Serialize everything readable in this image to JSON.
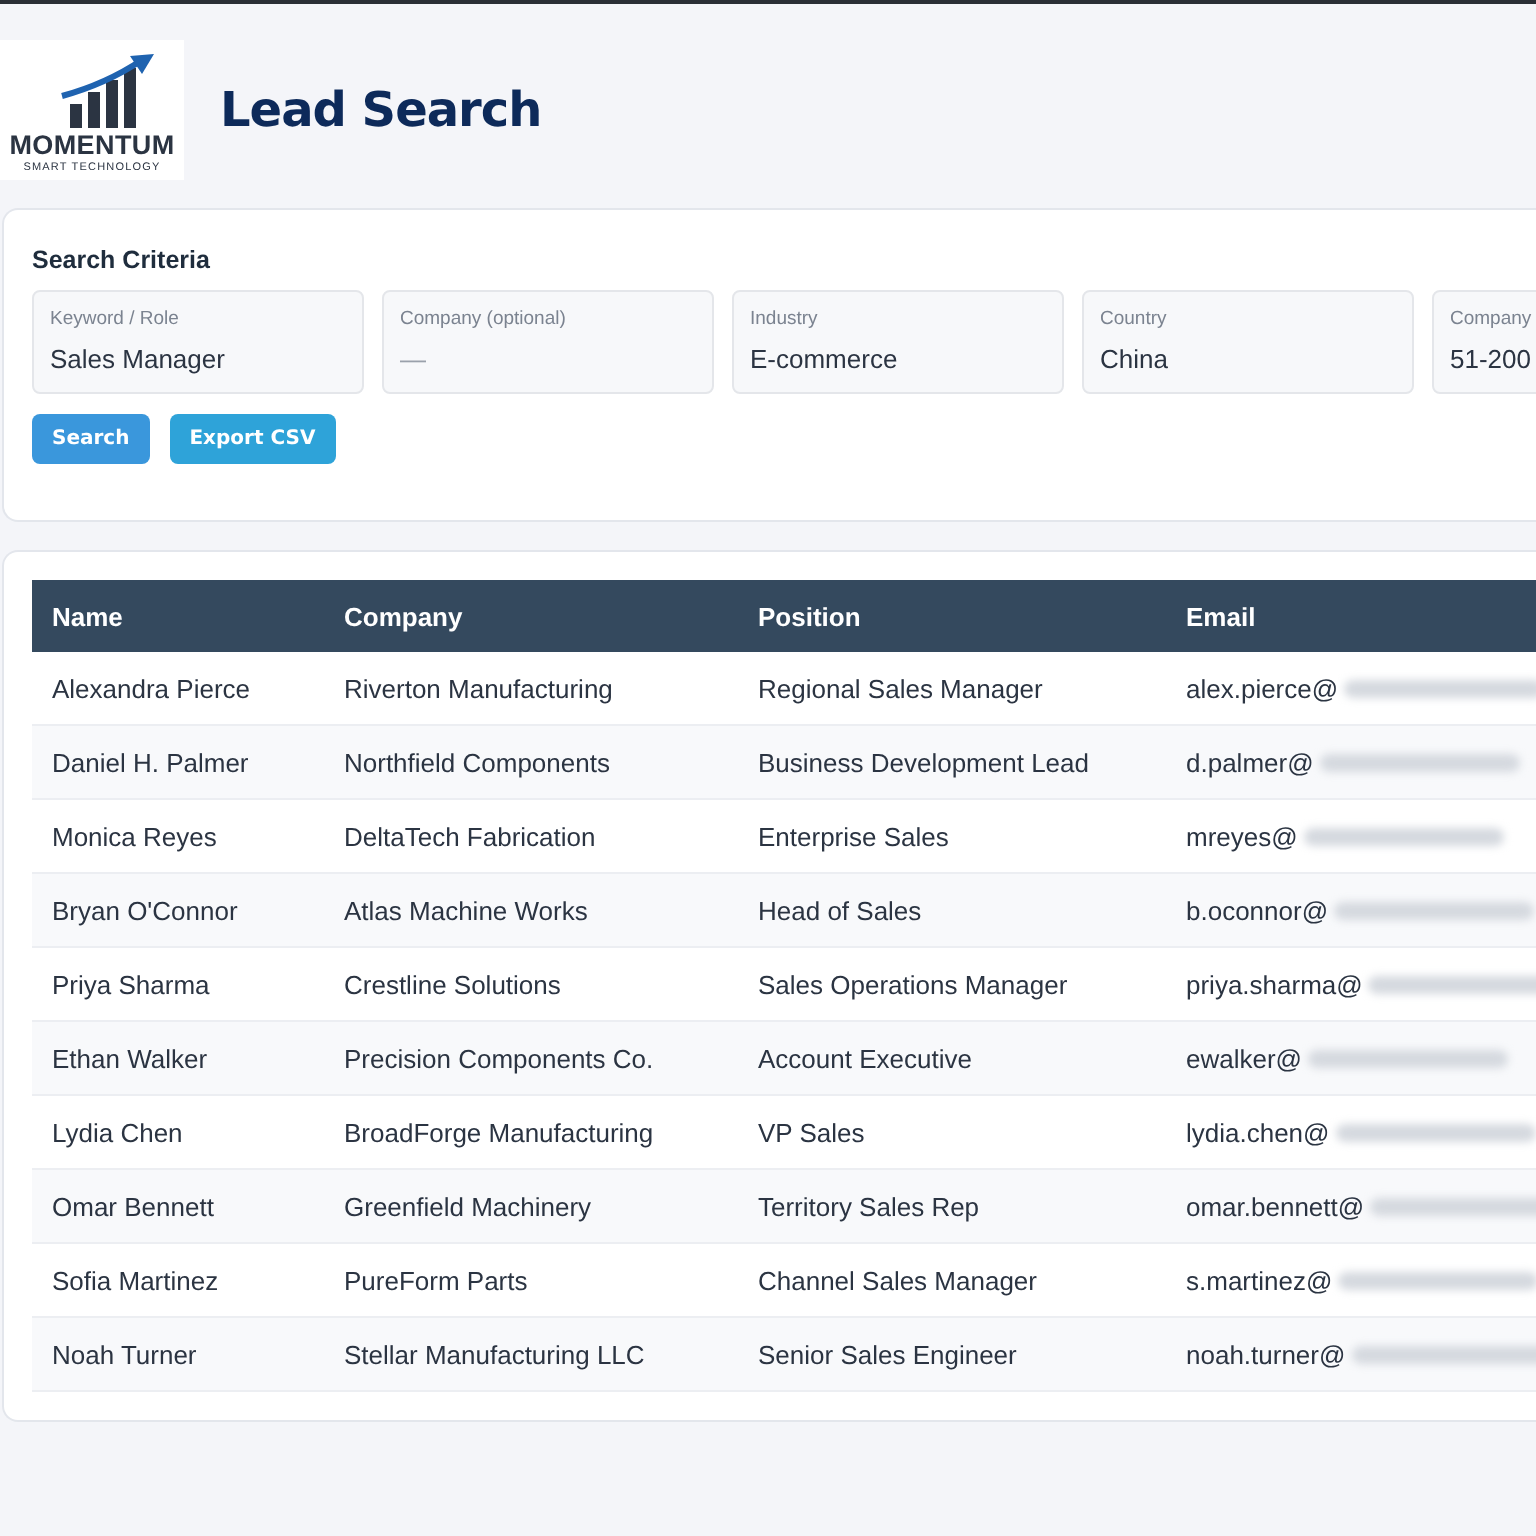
{
  "logo": {
    "name": "MOMENTUM",
    "tagline": "SMART TECHNOLOGY"
  },
  "page_title": "Lead Search",
  "search_criteria": {
    "title": "Search Criteria",
    "fields": [
      {
        "label": "Keyword / Role",
        "value": "Sales Manager"
      },
      {
        "label": "Company (optional)",
        "placeholder": "—"
      },
      {
        "label": "Industry",
        "value": "E-commerce"
      },
      {
        "label": "Country",
        "value": "China"
      },
      {
        "label": "Company",
        "value": "51-200"
      }
    ],
    "buttons": [
      {
        "label": "Search",
        "kind": "primary"
      },
      {
        "label": "Export CSV",
        "kind": "secondary"
      }
    ]
  },
  "table": {
    "columns": [
      "Name",
      "Company",
      "Position",
      "Email"
    ],
    "rows": [
      {
        "name": "Alexandra Pierce",
        "company": "Riverton Manufacturing",
        "position": "Regional Sales Manager",
        "email": "alex.pierce@",
        "email_domain_blurred": true
      },
      {
        "name": "Daniel H. Palmer",
        "company": "Northfield Components",
        "position": "Business Development Lead",
        "email": "d.palmer@",
        "email_domain_blurred": true
      },
      {
        "name": "Monica Reyes",
        "company": "DeltaTech Fabrication",
        "position": "Enterprise Sales",
        "email": "mreyes@",
        "email_domain_blurred": true
      },
      {
        "name": "Bryan O'Connor",
        "company": "Atlas Machine Works",
        "position": "Head of Sales",
        "email": "b.oconnor@",
        "email_domain_blurred": true
      },
      {
        "name": "Priya Sharma",
        "company": "Crestline Solutions",
        "position": "Sales Operations Manager",
        "email": "priya.sharma@",
        "email_domain_blurred": true
      },
      {
        "name": "Ethan Walker",
        "company": "Precision Components Co.",
        "position": "Account Executive",
        "email": "ewalker@",
        "email_domain_blurred": true
      },
      {
        "name": "Lydia Chen",
        "company": "BroadForge Manufacturing",
        "position": "VP Sales",
        "email": "lydia.chen@",
        "email_domain_blurred": true
      },
      {
        "name": "Omar Bennett",
        "company": "Greenfield Machinery",
        "position": "Territory Sales Rep",
        "email": "omar.bennett@",
        "email_domain_blurred": true
      },
      {
        "name": "Sofia Martinez",
        "company": "PureForm Parts",
        "position": "Channel Sales Manager",
        "email": "s.martinez@",
        "email_domain_blurred": true
      },
      {
        "name": "Noah Turner",
        "company": "Stellar Manufacturing LLC",
        "position": "Senior Sales Engineer",
        "email": "noah.turner@",
        "email_domain_blurred": true
      }
    ]
  }
}
